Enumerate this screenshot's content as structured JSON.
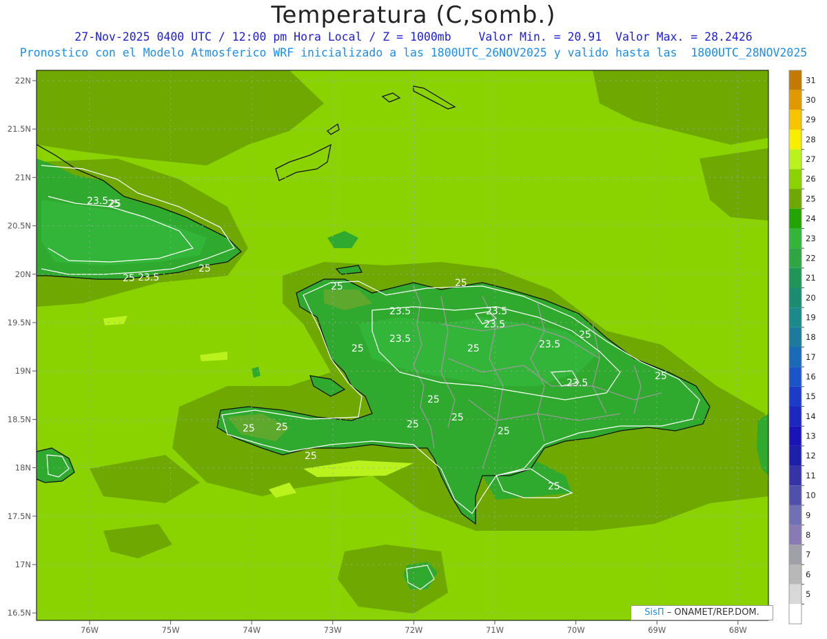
{
  "title": "Temperatura (C,somb.)",
  "subtitle_line1": "27-Nov-2025 0400 UTC / 12:00 pm Hora Local / Z = 1000mb    Valor Min. = 20.91  Valor Max. = 28.2426",
  "subtitle_line2": "Pronostico con el Modelo Atmosferico WRF inicializado a las 1800UTC_26NOV2025 y valido hasta las  1800UTC_28NOV2025",
  "credit": {
    "brand": "SisΠ",
    "org": " – ONAMET/REP.DOM."
  },
  "map": {
    "lat_labels": [
      "22N",
      "21.5N",
      "21N",
      "20.5N",
      "20N",
      "19.5N",
      "19N",
      "18.5N",
      "18N",
      "17.5N",
      "17N",
      "16.5N"
    ],
    "lon_labels": [
      "76W",
      "75W",
      "74W",
      "73W",
      "72W",
      "71W",
      "70W",
      "69W",
      "68W"
    ],
    "contour_labels": [
      "23.5",
      "25",
      "25",
      "23.5",
      "25",
      "25",
      "23.5",
      "23.5",
      "23.5",
      "25",
      "25",
      "23.5",
      "25",
      "23.5",
      "25",
      "23.5",
      "25",
      "25",
      "25",
      "25",
      "25",
      "25",
      "25",
      "25",
      "25",
      "25"
    ]
  },
  "colorbar": {
    "levels": [
      "31",
      "30",
      "29",
      "28",
      "27",
      "26",
      "25",
      "24",
      "23",
      "22",
      "21",
      "20",
      "19",
      "18",
      "17",
      "16",
      "15",
      "14",
      "13",
      "12",
      "11",
      "10",
      "9",
      "8",
      "7",
      "6",
      "5"
    ],
    "colors": [
      "#c47a00",
      "#e19900",
      "#f7c400",
      "#f9ee00",
      "#b9f21c",
      "#8ad300",
      "#6ea800",
      "#22a500",
      "#33b53a",
      "#2ea642",
      "#1e9656",
      "#1a8c70",
      "#1a8a8a",
      "#1c7a9c",
      "#1a6ab8",
      "#1a54c8",
      "#1a3cc8",
      "#1a28c0",
      "#1a14b8",
      "#1e1ea8",
      "#3434a8",
      "#5050ac",
      "#7070b4",
      "#8a7ab4",
      "#a0a0a8",
      "#b8b8b8",
      "#d8d8d8",
      "#ffffff"
    ]
  },
  "palette": {
    "land_high": "#5ea82e",
    "land": "#2faa2f",
    "sea": "#8ad300",
    "sea_cool": "#6ea800",
    "sea_warm": "#b9f21c",
    "grid": "#9aa99a"
  }
}
